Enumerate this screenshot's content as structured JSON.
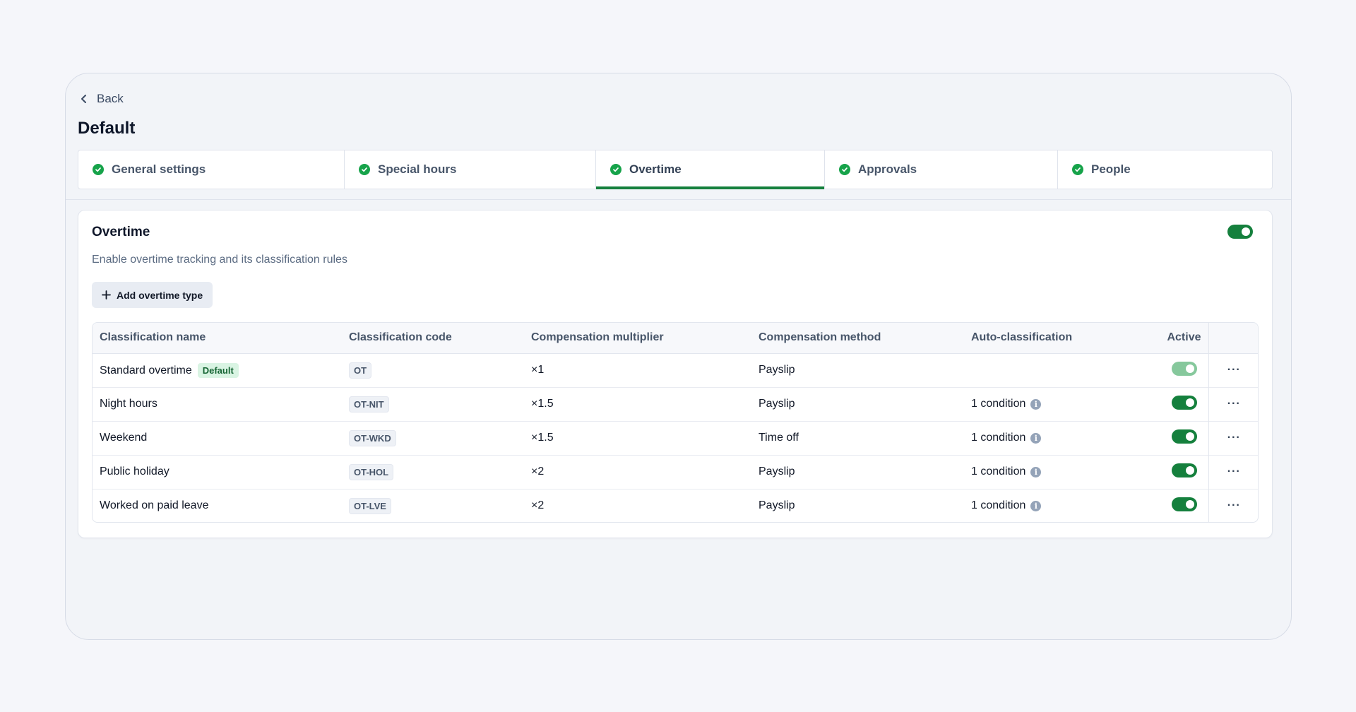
{
  "back_label": "Back",
  "page_title": "Default",
  "tabs": [
    {
      "label": "General settings"
    },
    {
      "label": "Special hours"
    },
    {
      "label": "Overtime",
      "active": true
    },
    {
      "label": "Approvals"
    },
    {
      "label": "People"
    }
  ],
  "overtime": {
    "title": "Overtime",
    "description": "Enable overtime tracking and its classification rules",
    "enabled": true,
    "add_button_label": "Add overtime type"
  },
  "table": {
    "headers": {
      "name": "Classification name",
      "code": "Classification code",
      "multiplier": "Compensation multiplier",
      "method": "Compensation method",
      "auto": "Auto-classification",
      "active": "Active"
    },
    "rows": [
      {
        "name": "Standard overtime",
        "badge": "Default",
        "code": "OT",
        "multiplier": "×1",
        "method": "Payslip",
        "auto": "",
        "active": true
      },
      {
        "name": "Night hours",
        "badge": "",
        "code": "OT-NIT",
        "multiplier": "×1.5",
        "method": "Payslip",
        "auto": "1 condition",
        "active": true
      },
      {
        "name": "Weekend",
        "badge": "",
        "code": "OT-WKD",
        "multiplier": "×1.5",
        "method": "Time off",
        "auto": "1 condition",
        "active": true
      },
      {
        "name": "Public holiday",
        "badge": "",
        "code": "OT-HOL",
        "multiplier": "×2",
        "method": "Payslip",
        "auto": "1 condition",
        "active": true
      },
      {
        "name": "Worked on paid leave",
        "badge": "",
        "code": "OT-LVE",
        "multiplier": "×2",
        "method": "Payslip",
        "auto": "1 condition",
        "active": true
      }
    ]
  },
  "colors": {
    "accent_green": "#15803d",
    "check_green": "#16a34a",
    "badge_bg": "#d9f4e3"
  }
}
